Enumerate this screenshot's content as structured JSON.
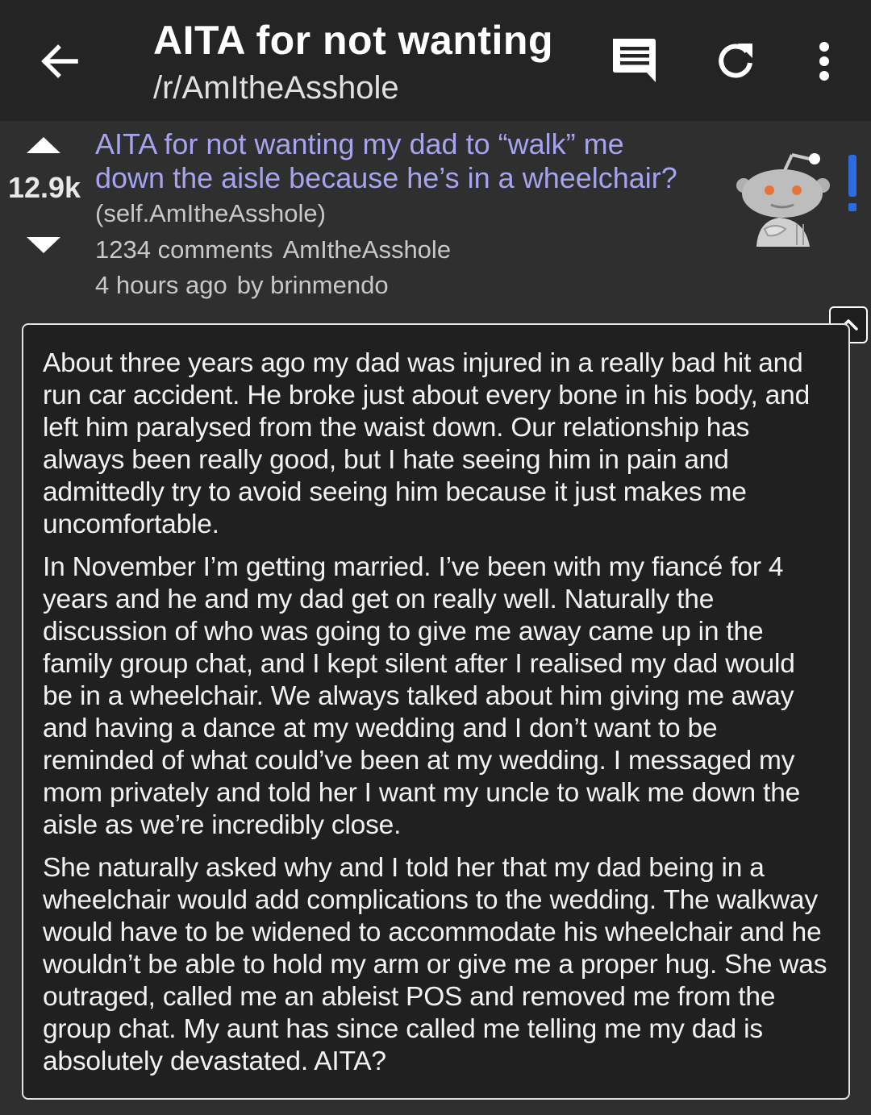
{
  "appbar": {
    "back_icon": "arrow-left-icon",
    "title": "AITA for not wanting",
    "subreddit": "/r/AmItheAsshole",
    "actions": [
      {
        "name": "comments",
        "icon": "comments-icon"
      },
      {
        "name": "refresh",
        "icon": "refresh-icon"
      },
      {
        "name": "more",
        "icon": "more-vert-icon"
      }
    ]
  },
  "post": {
    "score": "12.9k",
    "title_line1": "AITA for not wanting my dad to “walk” me",
    "title_line2": "down the aisle because he’s in a wheelchair?",
    "domain": "(self.AmItheAsshole)",
    "comments": "1234 comments",
    "subreddit": "AmItheAsshole",
    "time": "4 hours ago",
    "author": "by brinmendo",
    "thumbnail_icon": "reddit-snoo-icon",
    "flag_icon": "exclamation-icon"
  },
  "selftext": {
    "paragraphs": [
      "About three years ago my dad was injured in a really bad hit and run car accident. He broke just about every bone in his body, and left him paralysed from the waist down. Our relationship has always been really good, but I hate seeing him in pain and admittedly try to avoid seeing him because it just makes me uncomfortable.",
      "In November I’m getting married. I’ve been with my fiancé for 4 years and he and my dad get on really well. Naturally the discussion of who was going to give me away came up in the family group chat, and I kept silent after I realised my dad would be in a wheelchair. We always talked about him giving me away and having a dance at my wedding and I don’t want to be reminded of what could’ve been at my wedding. I messaged my mom privately and told her I want my uncle to walk me down the aisle as we’re incredibly close.",
      "She naturally asked why and I told her that my dad being in a wheelchair would add complications to the wedding. The walkway would have to be widened to accommodate his wheelchair and he wouldn’t be able to hold my arm or give me a proper hug. She was outraged, called me an ableist POS and removed me from the group chat. My aunt has since called me telling me my dad is absolutely devastated. AITA?"
    ]
  },
  "colors": {
    "background": "#2f2f2f",
    "appbar": "#242424",
    "title_link": "#a7a3ee",
    "snoo_eye": "#e8733a",
    "flag": "#2d6cdf"
  }
}
